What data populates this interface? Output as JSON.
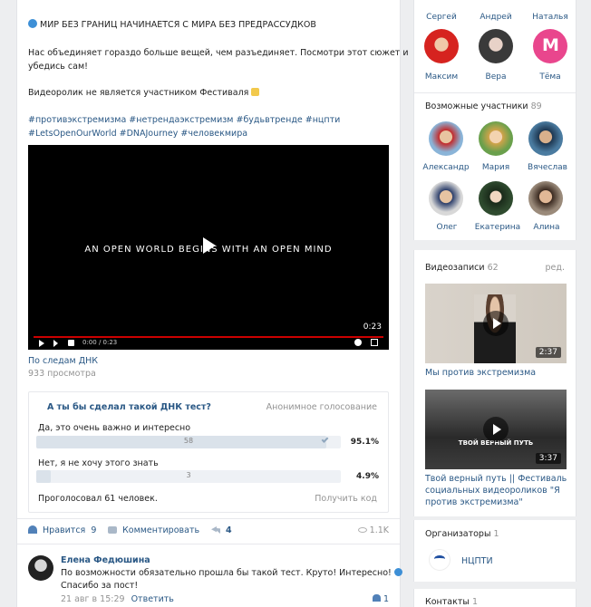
{
  "post": {
    "title": "МИР БЕЗ ГРАНИЦ НАЧИНАЕТСЯ С МИРА БЕЗ ПРЕДРАССУДКОВ",
    "body_line1": "Нас объединяет гораздо больше вещей, чем разъединяет. Посмотри этот сюжет и",
    "body_line2": "убедись сам!",
    "note": "Видеоролик не является участником Фестиваля",
    "hashtags1": "#противэкстремизма #нетрендаэкстремизм #будьвтренде #нцпти",
    "hashtags2": "#LetsOpenOurWorld #DNAJourney #человекмира",
    "video": {
      "overlay_text": "AN OPEN WORLD BEGINS WITH AN OPEN MIND",
      "time": "0:00 / 0:23",
      "duration": "0:23",
      "title": "По следам ДНК",
      "views": "933 просмотра"
    },
    "poll": {
      "question": "А ты бы сделал такой ДНК тест?",
      "type": "Анонимное голосование",
      "options": [
        {
          "label": "Да, это очень важно и интересно",
          "count": "58",
          "percent": "95.1%",
          "fill": 0.951
        },
        {
          "label": "Нет, я не хочу этого знать",
          "count": "3",
          "percent": "4.9%",
          "fill": 0.049
        }
      ],
      "voted": "Проголосовал 61 человек.",
      "get_code": "Получить код"
    },
    "actions": {
      "like": "Нравится",
      "like_count": "9",
      "comment": "Комментировать",
      "share_count": "4",
      "views": "1.1K"
    },
    "comment": {
      "author": "Елена Федюшина",
      "text1": "По возможности обязательно прошла бы такой тест. Круто! Интересно!",
      "text2": "Спасибо за пост!",
      "date": "21 авг в 15:29",
      "reply": "Ответить",
      "likes": "1"
    }
  },
  "sidebar": {
    "members_top": [
      "Сергей",
      "Андрей",
      "Наталья"
    ],
    "members_row2": [
      "Максим",
      "Вера",
      "Тёма"
    ],
    "possible": {
      "label": "Возможные участники",
      "count": "89"
    },
    "possible_row1": [
      "Александр",
      "Мария",
      "Вячеслав"
    ],
    "possible_row2": [
      "Олег",
      "Екатерина",
      "Алина"
    ],
    "videos": {
      "label": "Видеозаписи",
      "count": "62",
      "edit": "ред."
    },
    "video1": {
      "title": "Мы против экстремизма",
      "duration": "2:37"
    },
    "video2": {
      "overlay": "ТВОЙ ВЕРНЫЙ ПУТЬ",
      "duration": "3:37",
      "title1": "Твой верный путь || Фестиваль",
      "title2": "социальных видеороликов \"Я",
      "title3": "против экстремизма\""
    },
    "organizers": {
      "label": "Организаторы",
      "count": "1",
      "name": "НЦПТИ"
    },
    "contacts": {
      "label": "Контакты",
      "count": "1"
    }
  }
}
